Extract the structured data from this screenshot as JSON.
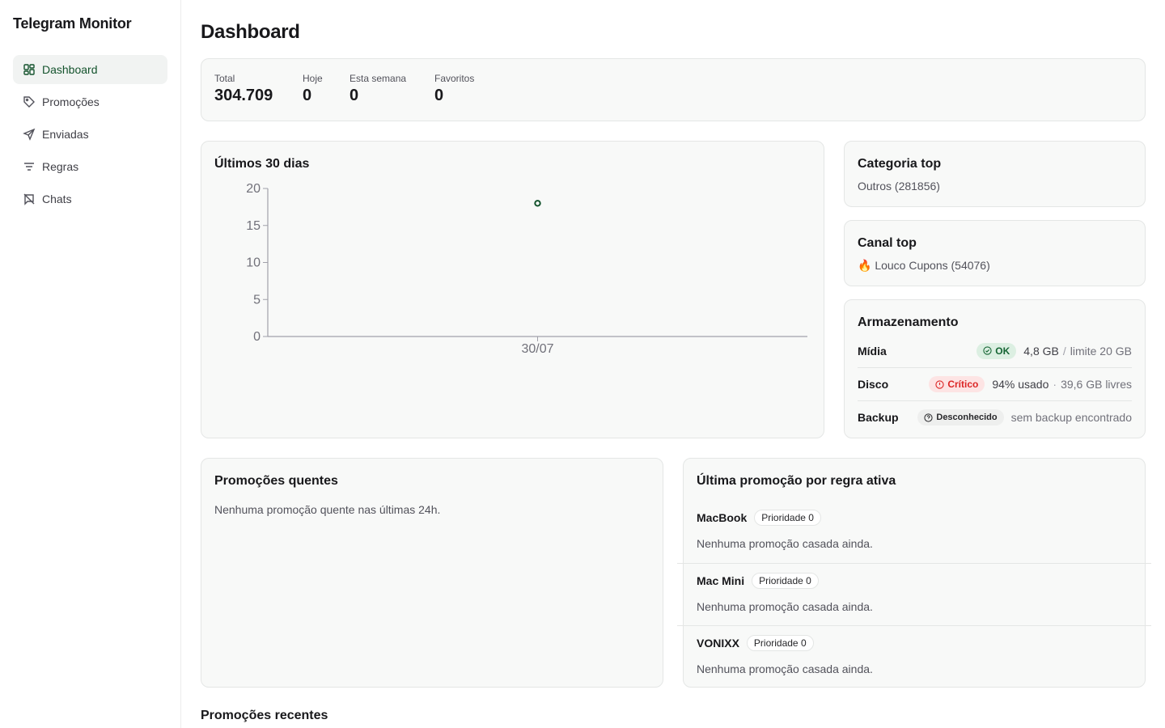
{
  "app": {
    "title": "Telegram Monitor"
  },
  "nav": [
    {
      "label": "Dashboard",
      "icon": "dashboard-icon",
      "active": true
    },
    {
      "label": "Promoções",
      "icon": "tag-icon",
      "active": false
    },
    {
      "label": "Enviadas",
      "icon": "send-icon",
      "active": false
    },
    {
      "label": "Regras",
      "icon": "filter-icon",
      "active": false
    },
    {
      "label": "Chats",
      "icon": "chat-off-icon",
      "active": false
    }
  ],
  "page": {
    "title": "Dashboard"
  },
  "stats": [
    {
      "label": "Total",
      "value": "304.709"
    },
    {
      "label": "Hoje",
      "value": "0"
    },
    {
      "label": "Esta semana",
      "value": "0"
    },
    {
      "label": "Favoritos",
      "value": "0"
    }
  ],
  "chart_data": {
    "type": "scatter",
    "title": "Últimos 30 dias",
    "x": [
      "30/07"
    ],
    "values": [
      18
    ],
    "ylim": [
      0,
      20
    ],
    "yticks": [
      0,
      5,
      10,
      15,
      20
    ],
    "xlabel": "",
    "ylabel": "",
    "grid": false,
    "color": "#14532d"
  },
  "category_top": {
    "title": "Categoria top",
    "value": "Outros (281856)"
  },
  "channel_top": {
    "title": "Canal top",
    "value": "🔥 Louco Cupons (54076)"
  },
  "storage": {
    "title": "Armazenamento",
    "rows": [
      {
        "name": "Mídia",
        "status": "OK",
        "status_type": "ok",
        "main": "4,8 GB",
        "sep": "/",
        "muted": "limite 20 GB"
      },
      {
        "name": "Disco",
        "status": "Crítico",
        "status_type": "crit",
        "main": "94% usado",
        "sep": "·",
        "muted": "39,6 GB livres"
      },
      {
        "name": "Backup",
        "status": "Desconhecido",
        "status_type": "unk",
        "main": "",
        "sep": "",
        "muted": "sem backup encontrado"
      }
    ]
  },
  "hot": {
    "title": "Promoções quentes",
    "empty": "Nenhuma promoção quente nas últimas 24h."
  },
  "rules": {
    "title": "Última promoção por regra ativa",
    "items": [
      {
        "name": "MacBook",
        "priority": "Prioridade 0",
        "empty": "Nenhuma promoção casada ainda."
      },
      {
        "name": "Mac Mini",
        "priority": "Prioridade 0",
        "empty": "Nenhuma promoção casada ainda."
      },
      {
        "name": "VONIXX",
        "priority": "Prioridade 0",
        "empty": "Nenhuma promoção casada ainda."
      }
    ]
  },
  "recent": {
    "title": "Promoções recentes"
  },
  "colors": {
    "accent": "#14532d",
    "ok": "#166534",
    "critical": "#dc2626"
  }
}
